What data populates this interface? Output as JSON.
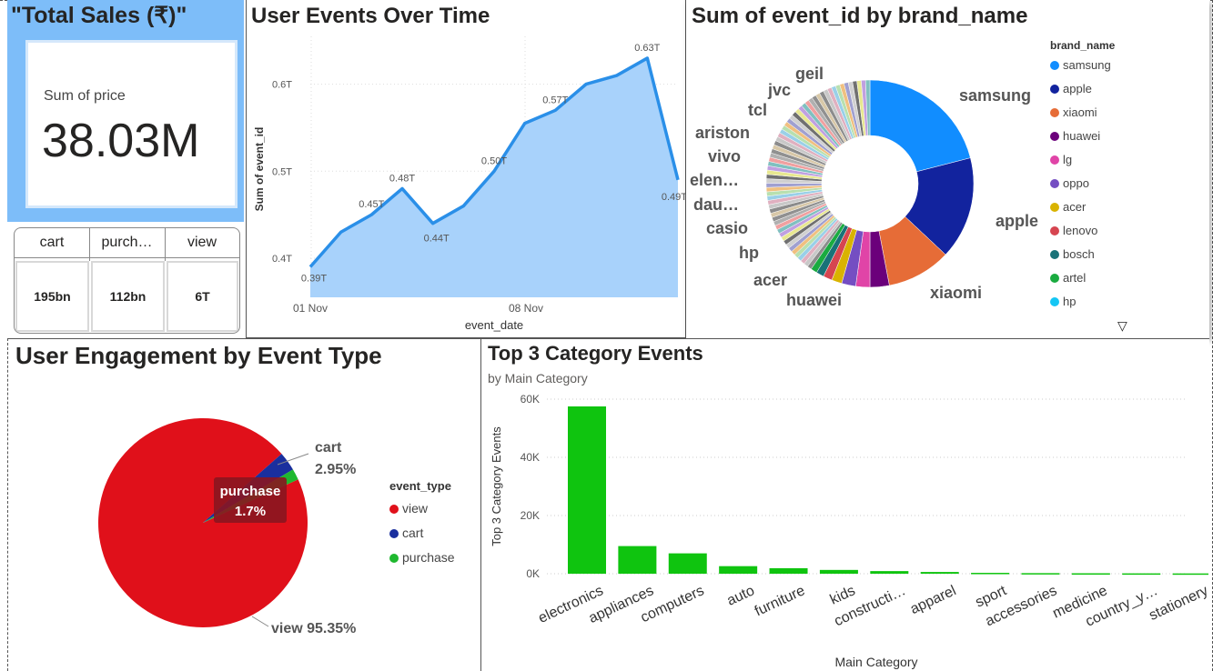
{
  "total_sales": {
    "title": "\"Total Sales (₹)\"",
    "label": "Sum of price",
    "value": "38.03M"
  },
  "event_table": {
    "headers": [
      "cart",
      "purch…",
      "view"
    ],
    "values": [
      "195bn",
      "112bn",
      "6T"
    ]
  },
  "line_chart": {
    "title": "User Events Over Time",
    "chart_data": {
      "type": "area",
      "xlabel": "event_date",
      "ylabel": "Sum of event_id",
      "x_ticks": [
        "01 Nov",
        "08 Nov"
      ],
      "y_ticks": [
        "0.4T",
        "0.5T",
        "0.6T"
      ],
      "ylim": [
        0.355,
        0.655
      ],
      "values": [
        0.39,
        0.43,
        0.45,
        0.48,
        0.44,
        0.46,
        0.5,
        0.555,
        0.57,
        0.6,
        0.61,
        0.63,
        0.49
      ],
      "labels": [
        "0.39T",
        "",
        "0.45T",
        "0.48T",
        "0.44T",
        "",
        "0.50T",
        "",
        "0.57T",
        "",
        "",
        "0.63T",
        "0.49T"
      ],
      "line_color": "#2a8fe8",
      "fill_color": "#a8d2fb"
    }
  },
  "donut_chart": {
    "title": "Sum of event_id by brand_name",
    "legend_title": "brand_name",
    "legend": [
      {
        "name": "samsung",
        "color": "#118dff"
      },
      {
        "name": "apple",
        "color": "#12239e"
      },
      {
        "name": "xiaomi",
        "color": "#e66c37"
      },
      {
        "name": "huawei",
        "color": "#6b007b"
      },
      {
        "name": "lg",
        "color": "#e044a7"
      },
      {
        "name": "oppo",
        "color": "#744ec2"
      },
      {
        "name": "acer",
        "color": "#d9b300"
      },
      {
        "name": "lenovo",
        "color": "#d64550"
      },
      {
        "name": "bosch",
        "color": "#197278"
      },
      {
        "name": "artel",
        "color": "#1aab40"
      },
      {
        "name": "hp",
        "color": "#15c6f4"
      }
    ],
    "slice_labels": [
      "samsung",
      "apple",
      "xiaomi",
      "huawei",
      "acer",
      "hp",
      "casio",
      "dau…",
      "elen…",
      "vivo",
      "ariston",
      "tcl",
      "jvc",
      "geil"
    ],
    "chart_data": {
      "type": "pie",
      "values": [
        21,
        16,
        10,
        3,
        2.2,
        2.2,
        1.6,
        1.4,
        1.2,
        1.0,
        40.4
      ],
      "colors": [
        "#118dff",
        "#12239e",
        "#e66c37",
        "#6b007b",
        "#e044a7",
        "#744ec2",
        "#d9b300",
        "#d64550",
        "#197278",
        "#1aab40",
        "#b0b0b0"
      ]
    }
  },
  "pie_chart": {
    "title": "User Engagement by Event Type",
    "legend_title": "event_type",
    "legend": [
      {
        "name": "view",
        "color": "#e0101a"
      },
      {
        "name": "cart",
        "color": "#1a2f9e"
      },
      {
        "name": "purchase",
        "color": "#1fb82f"
      }
    ],
    "chart_data": {
      "type": "pie",
      "categories": [
        "view",
        "cart",
        "purchase"
      ],
      "values": [
        95.35,
        2.95,
        1.7
      ],
      "labels": [
        "view 95.35%",
        "2.95%",
        "1.7%"
      ],
      "colors": [
        "#e0101a",
        "#1a2f9e",
        "#1fb82f"
      ]
    },
    "tooltip_label": "purchase",
    "tooltip_value": "1.7%",
    "cart_label": "cart"
  },
  "bar_chart": {
    "title": "Top 3 Category Events",
    "subtitle": "by Main Category",
    "chart_data": {
      "type": "bar",
      "categories": [
        "electronics",
        "appliances",
        "computers",
        "auto",
        "furniture",
        "kids",
        "constructi…",
        "apparel",
        "sport",
        "accessories",
        "medicine",
        "country_y…",
        "stationery"
      ],
      "values": [
        57500,
        9500,
        7000,
        2600,
        1900,
        1300,
        900,
        600,
        300,
        200,
        150,
        120,
        100
      ],
      "xlabel": "Main Category",
      "ylabel": "Top 3 Category Events",
      "y_ticks": [
        "0K",
        "20K",
        "40K",
        "60K"
      ],
      "ylim": [
        0,
        60000
      ],
      "color": "#0fc40f"
    }
  }
}
